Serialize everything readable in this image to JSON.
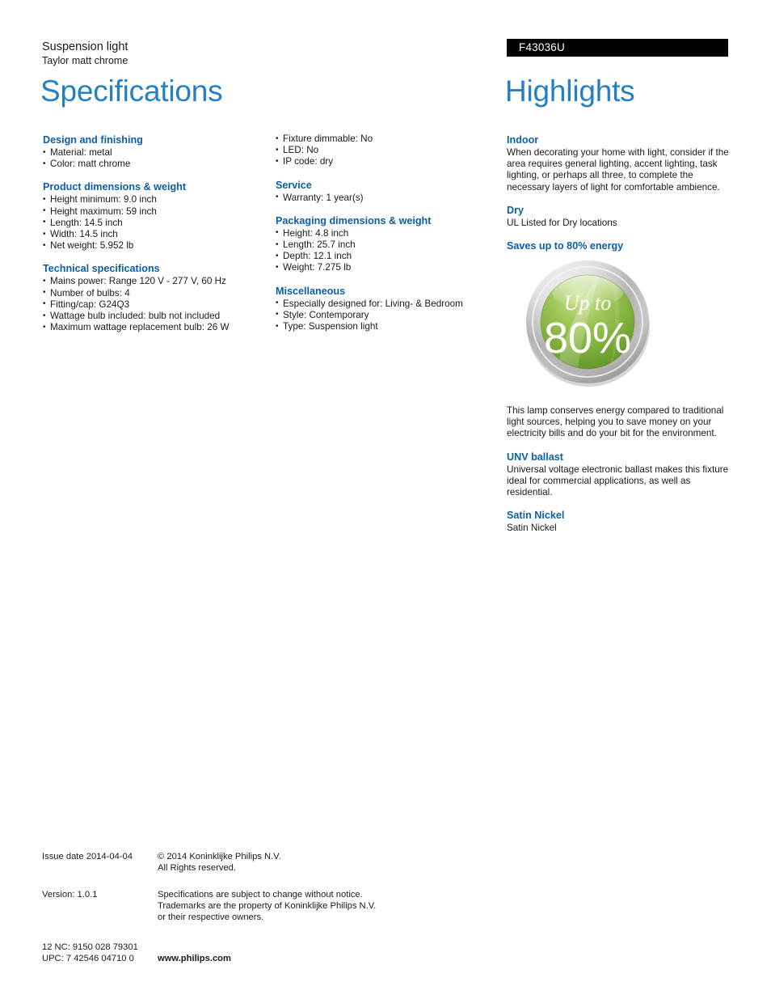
{
  "header": {
    "product_type": "Suspension light",
    "product_name": "Taylor matt chrome",
    "product_code": "F43036U",
    "spec_title": "Specifications",
    "highlights_title": "Highlights"
  },
  "specifications": {
    "column_a": [
      {
        "heading": "Design and finishing",
        "items": [
          "Material: metal",
          "Color: matt chrome"
        ]
      },
      {
        "heading": "Product dimensions & weight",
        "items": [
          "Height minimum: 9.0 inch",
          "Height maximum: 59 inch",
          "Length: 14.5 inch",
          "Width: 14.5 inch",
          "Net weight: 5.952 lb"
        ]
      },
      {
        "heading": "Technical specifications",
        "items": [
          "Mains power: Range 120 V - 277 V, 60 Hz",
          "Number of bulbs: 4",
          "Fitting/cap: G24Q3",
          "Wattage bulb included: bulb not included",
          "Maximum wattage replacement bulb: 26 W"
        ]
      }
    ],
    "column_b": [
      {
        "heading": "",
        "items": [
          "Fixture dimmable: No",
          "LED: No",
          "IP code: dry"
        ]
      },
      {
        "heading": "Service",
        "items": [
          "Warranty: 1 year(s)"
        ]
      },
      {
        "heading": "Packaging dimensions & weight",
        "items": [
          "Height: 4.8 inch",
          "Length: 25.7 inch",
          "Depth: 12.1 inch",
          "Weight: 7.275 lb"
        ]
      },
      {
        "heading": "Miscellaneous",
        "items": [
          "Especially designed for: Living- & Bedroom",
          "Style: Contemporary",
          "Type: Suspension light"
        ]
      }
    ]
  },
  "highlights": {
    "indoor": {
      "heading": "Indoor",
      "text": "When decorating your home with light, consider if the area requires general lighting, accent lighting, task lighting, or perhaps all three, to complete the necessary layers of light for comfortable ambience."
    },
    "dry": {
      "heading": "Dry",
      "text": "UL Listed for Dry locations"
    },
    "energy": {
      "heading": "Saves up to 80% energy",
      "badge_top_label": "Up to",
      "badge_value": "80%",
      "text": "This lamp conserves energy compared to traditional light sources, helping you to save money on your electricity bills and do your bit for the environment."
    },
    "ballast": {
      "heading": "UNV ballast",
      "text": "Universal voltage electronic ballast makes this fixture ideal for commercial applications, as well as residential."
    },
    "finish": {
      "heading": "Satin Nickel",
      "text": "Satin Nickel"
    }
  },
  "footer": {
    "issue_date": "Issue date 2014-04-04",
    "copyright_line1": "© 2014 Koninklijke Philips N.V.",
    "copyright_line2": "All Rights reserved.",
    "version": "Version: 1.0.1",
    "disclaimer_line1": "Specifications are subject to change without notice.",
    "disclaimer_line2": "Trademarks are the property of Koninklijke Philips N.V.",
    "disclaimer_line3": "or their respective owners.",
    "nc_code": "12 NC: 9150 028 79301",
    "upc_code": "UPC: 7 42546 04710 0",
    "website": "www.philips.com"
  },
  "colors": {
    "heading_blue": "#0b5ea8",
    "title_blue": "#2580c3",
    "code_bar_bg": "#000000",
    "badge_green": "#7fae3a",
    "badge_ring": "#b8b8b8"
  }
}
